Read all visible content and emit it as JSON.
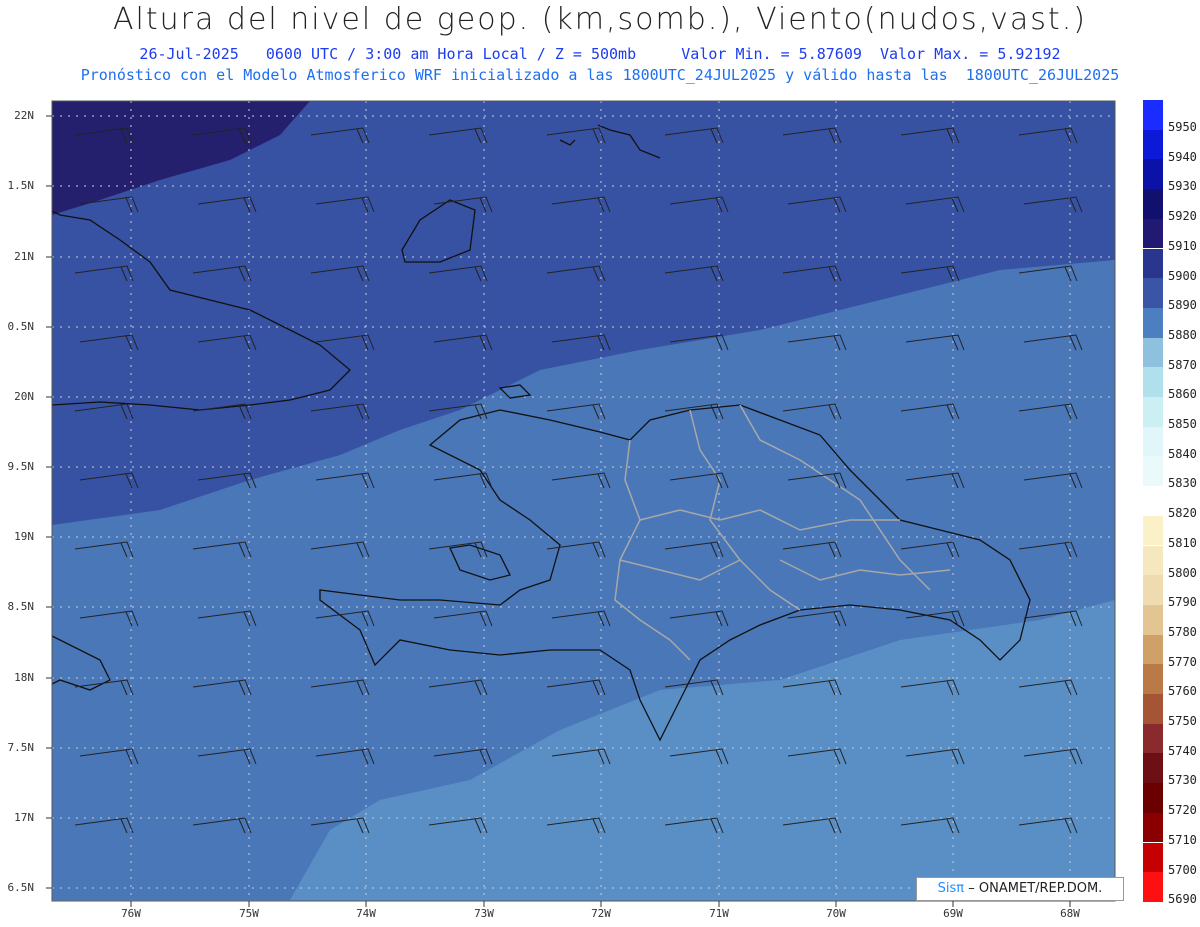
{
  "title": "Altura del nivel de geop. (km,somb.), Viento(nudos,vast.)",
  "subtitle_line1": "26-Jul-2025   0600 UTC / 3:00 am Hora Local / Z = 500mb     Valor Min. = 5.87609  Valor Max. = 5.92192",
  "subtitle_line2": "Pronóstico con el Modelo Atmosferico WRF inicializado a las 1800UTC_24JUL2025 y válido hasta las  1800UTC_26JUL2025",
  "lat_labels": [
    "22N",
    "1.5N",
    "21N",
    "0.5N",
    "20N",
    "9.5N",
    "19N",
    "8.5N",
    "18N",
    "7.5N",
    "17N",
    "6.5N"
  ],
  "lon_labels": [
    "76W",
    "75W",
    "74W",
    "73W",
    "72W",
    "71W",
    "70W",
    "69W",
    "68W"
  ],
  "colorbar": {
    "ticks": [
      "5950",
      "5940",
      "5930",
      "5920",
      "5910",
      "5900",
      "5890",
      "5880",
      "5870",
      "5860",
      "5850",
      "5840",
      "5830",
      "5820",
      "5810",
      "5800",
      "5790",
      "5780",
      "5770",
      "5760",
      "5750",
      "5740",
      "5730",
      "5720",
      "5710",
      "5700",
      "5690"
    ],
    "colors": [
      "#1a2cff",
      "#0c1ad8",
      "#0a12a8",
      "#12106e",
      "#221a72",
      "#2a358e",
      "#3a55a6",
      "#4b7fbf",
      "#8ec1de",
      "#b0e0ec",
      "#cceff4",
      "#e0f6f8",
      "#eafafb",
      "#ffffff",
      "#faf1c8",
      "#f5e8be",
      "#eedcb0",
      "#e3c594",
      "#cfa068",
      "#b97a48",
      "#a55535",
      "#8a2a2c",
      "#6d1015",
      "#6a0000",
      "#8a0000",
      "#c40000",
      "#ff1010"
    ]
  },
  "credit": {
    "sis": "Sisπ",
    "text": "– ONAMET/REP.DOM."
  }
}
